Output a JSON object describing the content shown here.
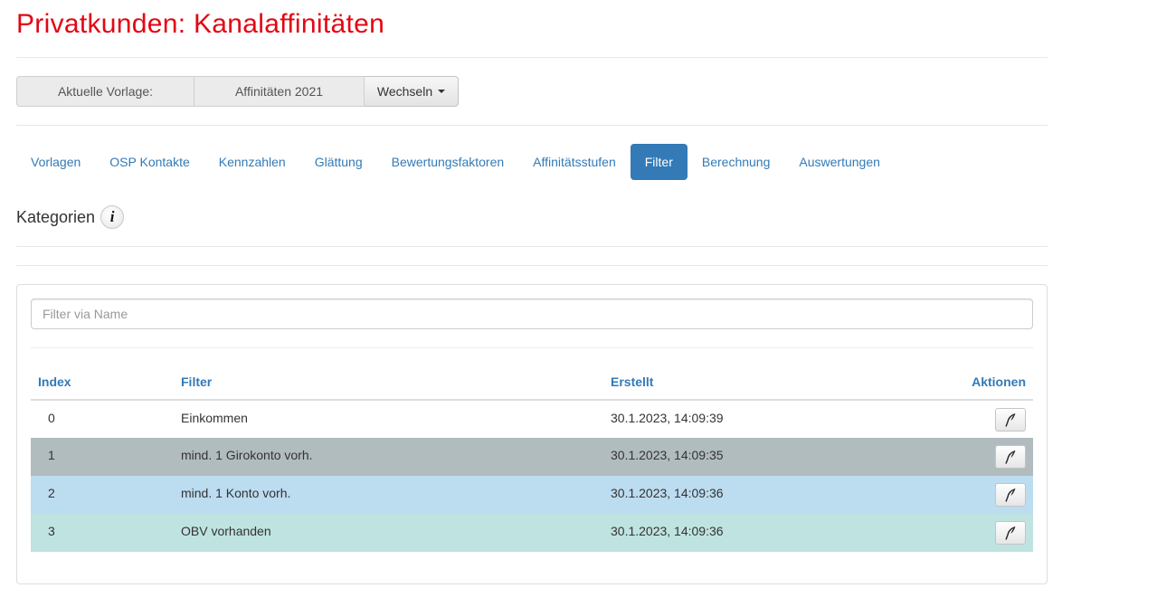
{
  "page": {
    "title": "Privatkunden: Kanalaffinitäten"
  },
  "template_bar": {
    "label": "Aktuelle Vorlage:",
    "value": "Affinitäten 2021",
    "switch_label": "Wechseln"
  },
  "nav": {
    "items": [
      {
        "label": "Vorlagen"
      },
      {
        "label": "OSP Kontakte"
      },
      {
        "label": "Kennzahlen"
      },
      {
        "label": "Glättung"
      },
      {
        "label": "Bewertungsfaktoren"
      },
      {
        "label": "Affinitätsstufen"
      },
      {
        "label": "Filter"
      },
      {
        "label": "Berechnung"
      },
      {
        "label": "Auswertungen"
      }
    ],
    "active": "Filter"
  },
  "section": {
    "title": "Kategorien",
    "info_icon": "info-icon"
  },
  "filter": {
    "placeholder": "Filter via Name",
    "value": ""
  },
  "table": {
    "columns": [
      "Index",
      "Filter",
      "Erstellt",
      "Aktionen"
    ],
    "rows": [
      {
        "index": "0",
        "filter": "Einkommen",
        "created": "30.1.2023, 14:09:39",
        "action_icon": "feather-edit-icon"
      },
      {
        "index": "1",
        "filter": "mind. 1 Girokonto vorh.",
        "created": "30.1.2023, 14:09:35",
        "action_icon": "feather-edit-icon"
      },
      {
        "index": "2",
        "filter": "mind. 1 Konto vorh.",
        "created": "30.1.2023, 14:09:36",
        "action_icon": "feather-edit-icon"
      },
      {
        "index": "3",
        "filter": "OBV vorhanden",
        "created": "30.1.2023, 14:09:36",
        "action_icon": "feather-edit-icon"
      }
    ]
  },
  "colors": {
    "title": "#e30613",
    "link": "#337ab7",
    "row_1": "#b1bcbf",
    "row_2": "#bcdcf0",
    "row_3": "#bfe3e1"
  }
}
